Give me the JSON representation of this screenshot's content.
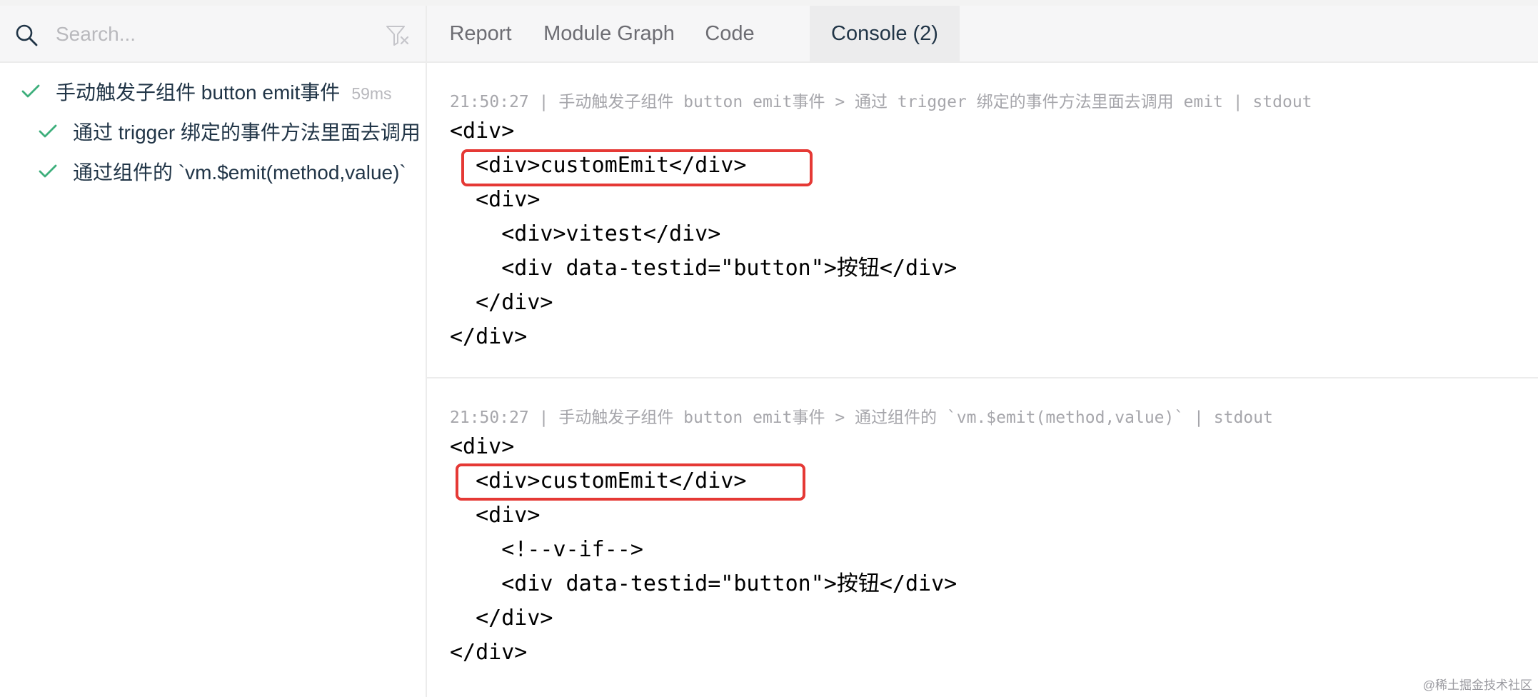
{
  "search": {
    "placeholder": "Search..."
  },
  "sidebar": {
    "suite": {
      "label": "手动触发子组件 button emit事件",
      "duration": "59ms",
      "status": "pass"
    },
    "tests": [
      {
        "label": "通过 trigger 绑定的事件方法里面去调用 emit",
        "status": "pass"
      },
      {
        "label": "通过组件的 `vm.$emit(method,value)`",
        "status": "pass"
      }
    ]
  },
  "tabs": [
    {
      "label": "Report",
      "active": false
    },
    {
      "label": "Module Graph",
      "active": false
    },
    {
      "label": "Code",
      "active": false
    },
    {
      "label": "Console (2)",
      "active": true
    }
  ],
  "console": {
    "entries": [
      {
        "header": "21:50:27 | 手动触发子组件 button emit事件 > 通过 trigger 绑定的事件方法里面去调用 emit | stdout",
        "lines": [
          "<div>",
          "  <div>customEmit</div>",
          "  <div>",
          "    <div>vitest</div>",
          "    <div data-testid=\"button\">按钮</div>",
          "  </div>",
          "</div>"
        ]
      },
      {
        "header": "21:50:27 | 手动触发子组件 button emit事件 > 通过组件的 `vm.$emit(method,value)` | stdout",
        "lines": [
          "<div>",
          "  <div>customEmit</div>",
          "  <div>",
          "    <!--v-if-->",
          "    <div data-testid=\"button\">按钮</div>",
          "  </div>",
          "</div>"
        ]
      }
    ]
  },
  "watermark": "@稀土掘金技术社区",
  "colors": {
    "pass": "#3eaf7c",
    "highlight": "#e53935",
    "accent": "#213547"
  }
}
